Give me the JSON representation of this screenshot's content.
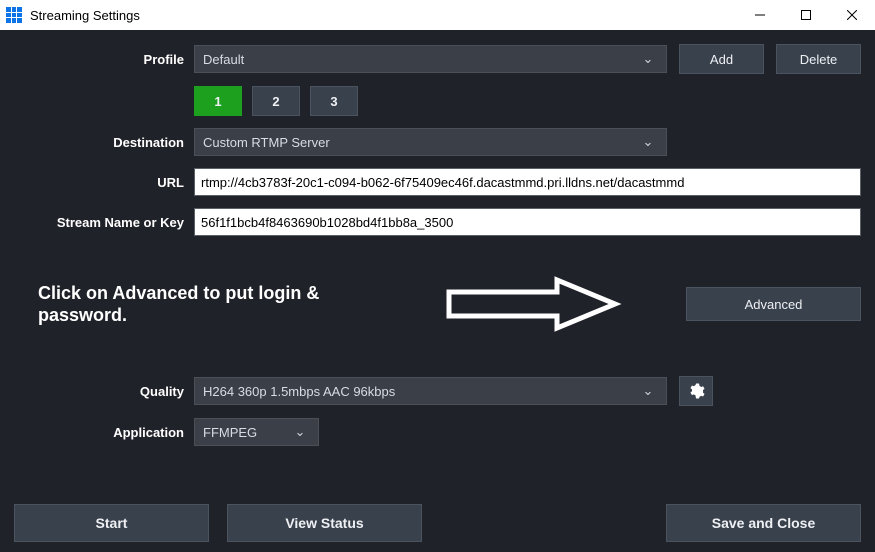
{
  "window": {
    "title": "Streaming Settings"
  },
  "profile": {
    "label": "Profile",
    "value": "Default",
    "add": "Add",
    "delete": "Delete"
  },
  "tabs": {
    "t1": "1",
    "t2": "2",
    "t3": "3"
  },
  "destination": {
    "label": "Destination",
    "value": "Custom RTMP Server"
  },
  "url": {
    "label": "URL",
    "value": "rtmp://4cb3783f-20c1-c094-b062-6f75409ec46f.dacastmmd.pri.lldns.net/dacastmmd"
  },
  "streamkey": {
    "label": "Stream Name or Key",
    "value": "56f1f1bcb4f8463690b1028bd4f1bb8a_3500"
  },
  "annotation": "Click on Advanced to put login & password.",
  "advanced": "Advanced",
  "quality": {
    "label": "Quality",
    "value": "H264 360p 1.5mbps AAC 96kbps"
  },
  "application": {
    "label": "Application",
    "value": "FFMPEG"
  },
  "footer": {
    "start": "Start",
    "viewstatus": "View Status",
    "saveclose": "Save and Close"
  }
}
